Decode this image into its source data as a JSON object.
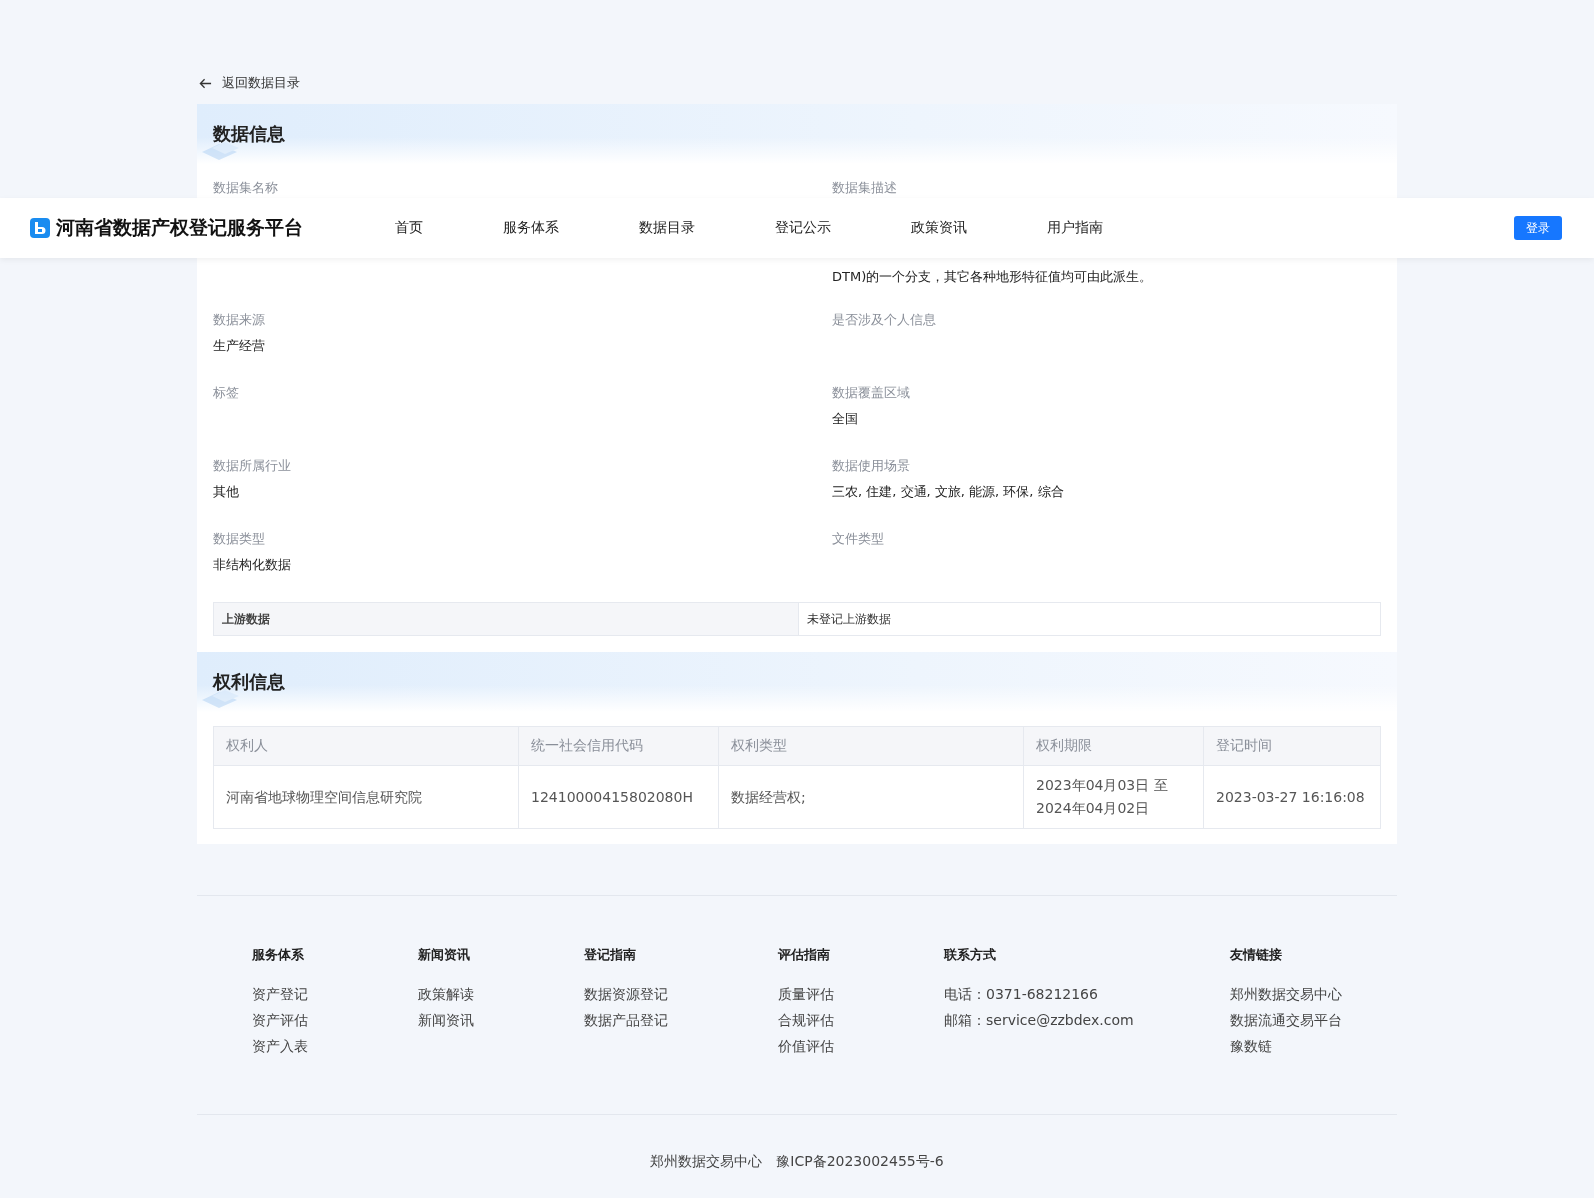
{
  "back_link": {
    "label": "返回数据目录"
  },
  "nav": {
    "brand": "河南省数据产权登记服务平台",
    "items": [
      "首页",
      "服务体系",
      "数据目录",
      "登记公示",
      "政策资讯",
      "用户指南"
    ],
    "login": "登录"
  },
  "data_info": {
    "title": "数据信息",
    "fields": [
      {
        "label": "数据集名称"
      },
      {
        "label": "数据集描述",
        "value_lines": [
          "DTM)的一个分支，其它各种地形特征值均可由此派生。"
        ]
      },
      {
        "label": "数据来源",
        "value_lines": [
          "生产经营"
        ]
      },
      {
        "label": "是否涉及个人信息"
      },
      {
        "label": "标签"
      },
      {
        "label": "数据覆盖区域",
        "value_lines": [
          "全国"
        ]
      },
      {
        "label": "数据所属行业",
        "value_lines": [
          "其他"
        ]
      },
      {
        "label": "数据使用场景",
        "value_lines": [
          "三农, 住建, 交通, 文旅, 能源, 环保, 综合"
        ]
      },
      {
        "label": "数据类型",
        "value_lines": [
          "非结构化数据"
        ]
      },
      {
        "label": "文件类型"
      }
    ],
    "upstream": {
      "label": "上游数据",
      "value": "未登记上游数据"
    }
  },
  "rights_info": {
    "title": "权利信息",
    "table": {
      "columns": [
        "权利人",
        "统一社会信用代码",
        "权利类型",
        "权利期限",
        "登记时间"
      ],
      "rows": [
        [
          "河南省地球物理空间信息研究院",
          "12410000415802080H",
          "数据经营权;",
          "2023年04月03日 至 2024年04月02日",
          "2023-03-27 16:16:08"
        ]
      ]
    }
  },
  "footer": {
    "columns": [
      {
        "title": "服务体系",
        "items": [
          "资产登记",
          "资产评估",
          "资产入表"
        ]
      },
      {
        "title": "新闻资讯",
        "items": [
          "政策解读",
          "新闻资讯"
        ]
      },
      {
        "title": "登记指南",
        "items": [
          "数据资源登记",
          "数据产品登记"
        ]
      },
      {
        "title": "评估指南",
        "items": [
          "质量评估",
          "合规评估",
          "价值评估"
        ]
      },
      {
        "title": "联系方式",
        "items": [
          "电话：0371-68212166",
          "邮箱：service@zzbdex.com"
        ]
      },
      {
        "title": "友情链接",
        "items": [
          "郑州数据交易中心",
          "数据流通交易平台",
          "豫数链"
        ]
      }
    ],
    "copyright": [
      "郑州数据交易中心",
      "豫ICP备2023002455号-6"
    ]
  }
}
